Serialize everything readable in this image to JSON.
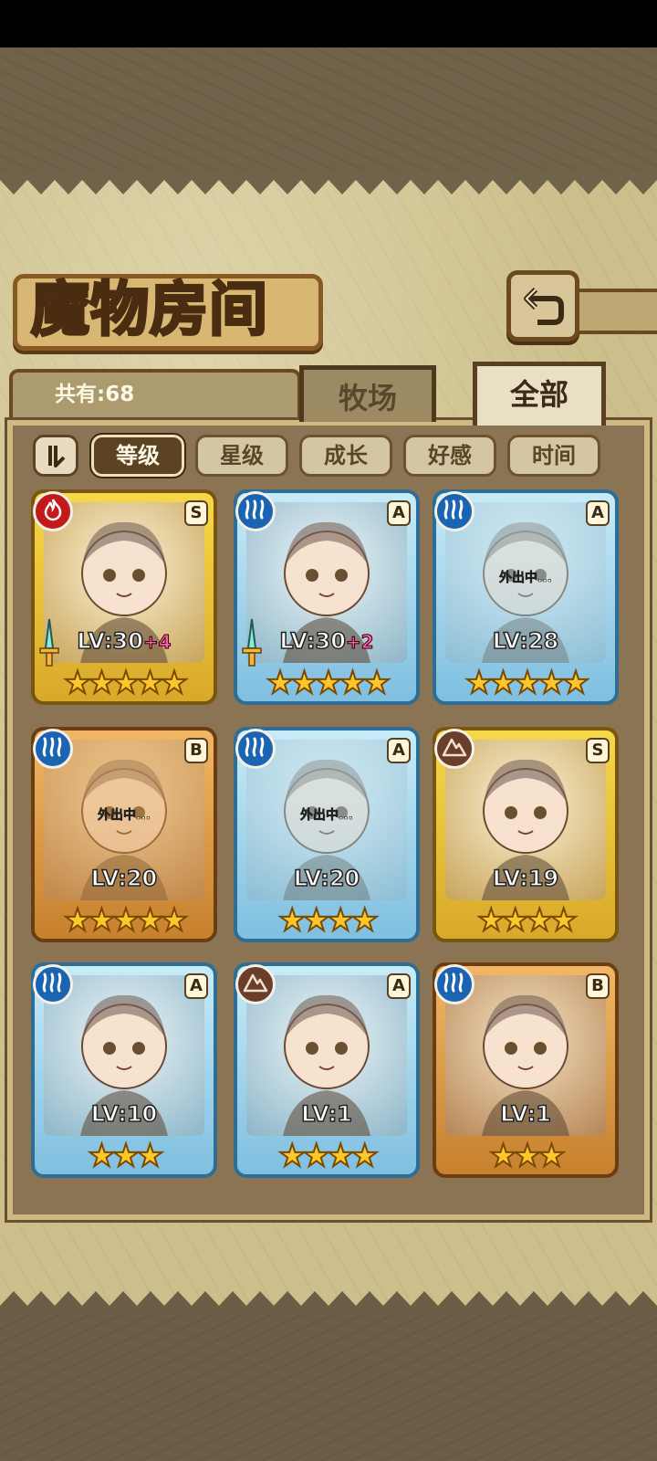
{
  "header": {
    "title": "魔物房间"
  },
  "count": {
    "label": "共有:68"
  },
  "tabs": [
    {
      "label": "牧场",
      "active": false
    },
    {
      "label": "全部",
      "active": true
    }
  ],
  "sort": {
    "options": [
      {
        "label": "等级",
        "active": true
      },
      {
        "label": "星级",
        "active": false
      },
      {
        "label": "成长",
        "active": false
      },
      {
        "label": "好感",
        "active": false
      },
      {
        "label": "时间",
        "active": false
      }
    ]
  },
  "cards": [
    {
      "element": "fire-icon",
      "rank": "S",
      "level": "LV:30",
      "bonus": "+4",
      "stars": "★★★★★",
      "frame": "gold",
      "status": "",
      "weapon": true
    },
    {
      "element": "water-icon",
      "rank": "A",
      "level": "LV:30",
      "bonus": "+2",
      "stars": "★★★★★",
      "frame": "blue",
      "status": "",
      "weapon": true
    },
    {
      "element": "water-icon",
      "rank": "A",
      "level": "LV:28",
      "bonus": "",
      "stars": "★★★★★",
      "frame": "blue",
      "status": "外出中...",
      "weapon": false
    },
    {
      "element": "water-icon",
      "rank": "B",
      "level": "LV:20",
      "bonus": "",
      "stars": "★★★★★",
      "frame": "bronze",
      "status": "外出中...",
      "weapon": false
    },
    {
      "element": "water-icon",
      "rank": "A",
      "level": "LV:20",
      "bonus": "",
      "stars": "★★★★",
      "frame": "blue",
      "status": "外出中...",
      "weapon": false
    },
    {
      "element": "earth-icon",
      "rank": "S",
      "level": "LV:19",
      "bonus": "",
      "stars": "★★★★",
      "frame": "gold",
      "status": "",
      "weapon": false
    },
    {
      "element": "water-icon",
      "rank": "A",
      "level": "LV:10",
      "bonus": "",
      "stars": "★★★",
      "frame": "blue",
      "status": "",
      "weapon": false
    },
    {
      "element": "earth-icon",
      "rank": "A",
      "level": "LV:1",
      "bonus": "",
      "stars": "★★★★",
      "frame": "blue",
      "status": "",
      "weapon": false
    },
    {
      "element": "water-icon",
      "rank": "B",
      "level": "LV:1",
      "bonus": "",
      "stars": "★★★",
      "frame": "bronze",
      "status": "",
      "weapon": false
    }
  ],
  "colors": {
    "parchment": "#cdbf8c",
    "wood": "#8a7453",
    "accent_dark": "#5b4223"
  }
}
